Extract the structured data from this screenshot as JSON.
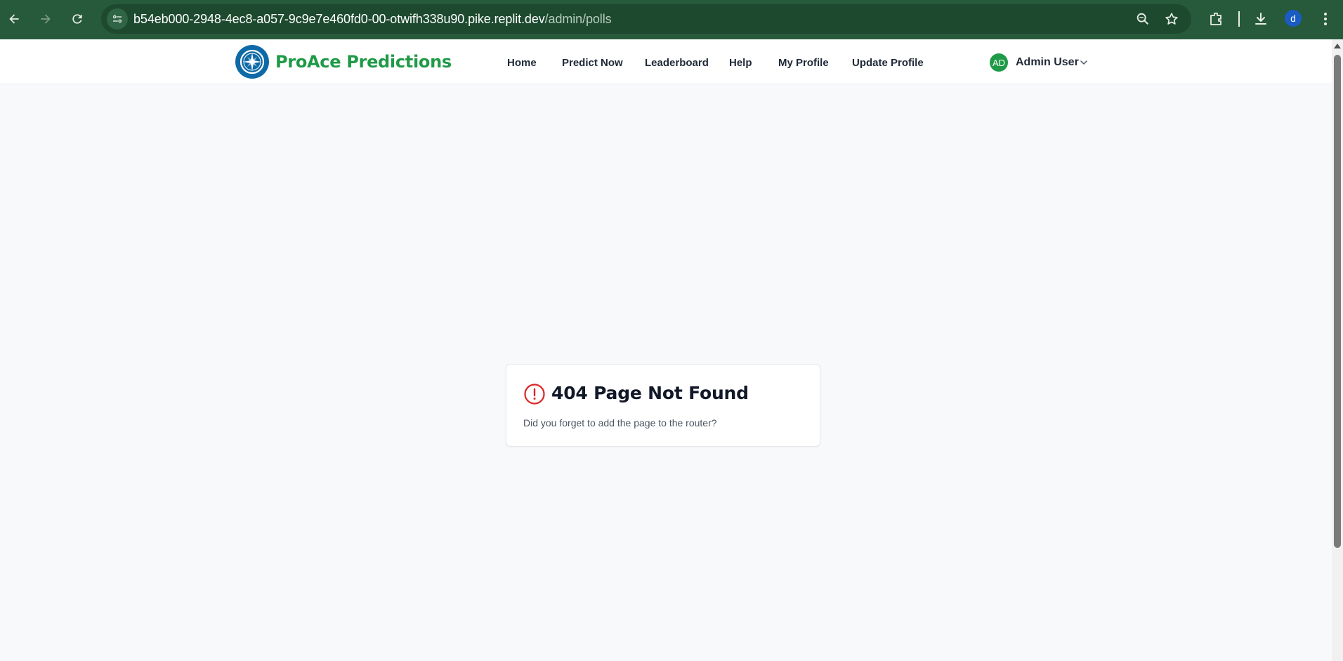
{
  "browser": {
    "url_host": "b54eb000-2948-4ec8-a057-9c9e7e460fd0-00-otwifh338u90.pike.replit.dev",
    "url_path": "/admin/polls",
    "profile_initial": "d"
  },
  "header": {
    "brand": "ProAce Predictions",
    "nav": [
      "Home",
      "Predict Now",
      "Leaderboard",
      "Help",
      "My Profile",
      "Update Profile"
    ],
    "user_initials": "AD",
    "user_name": "Admin User"
  },
  "error_card": {
    "title": "404 Page Not Found",
    "message": "Did you forget to add the page to the router?"
  },
  "colors": {
    "browser_chrome": "#275a3a",
    "brand_green": "#1f9a47",
    "logo_blue": "#0e6aa7",
    "error_red": "#dc2626"
  }
}
